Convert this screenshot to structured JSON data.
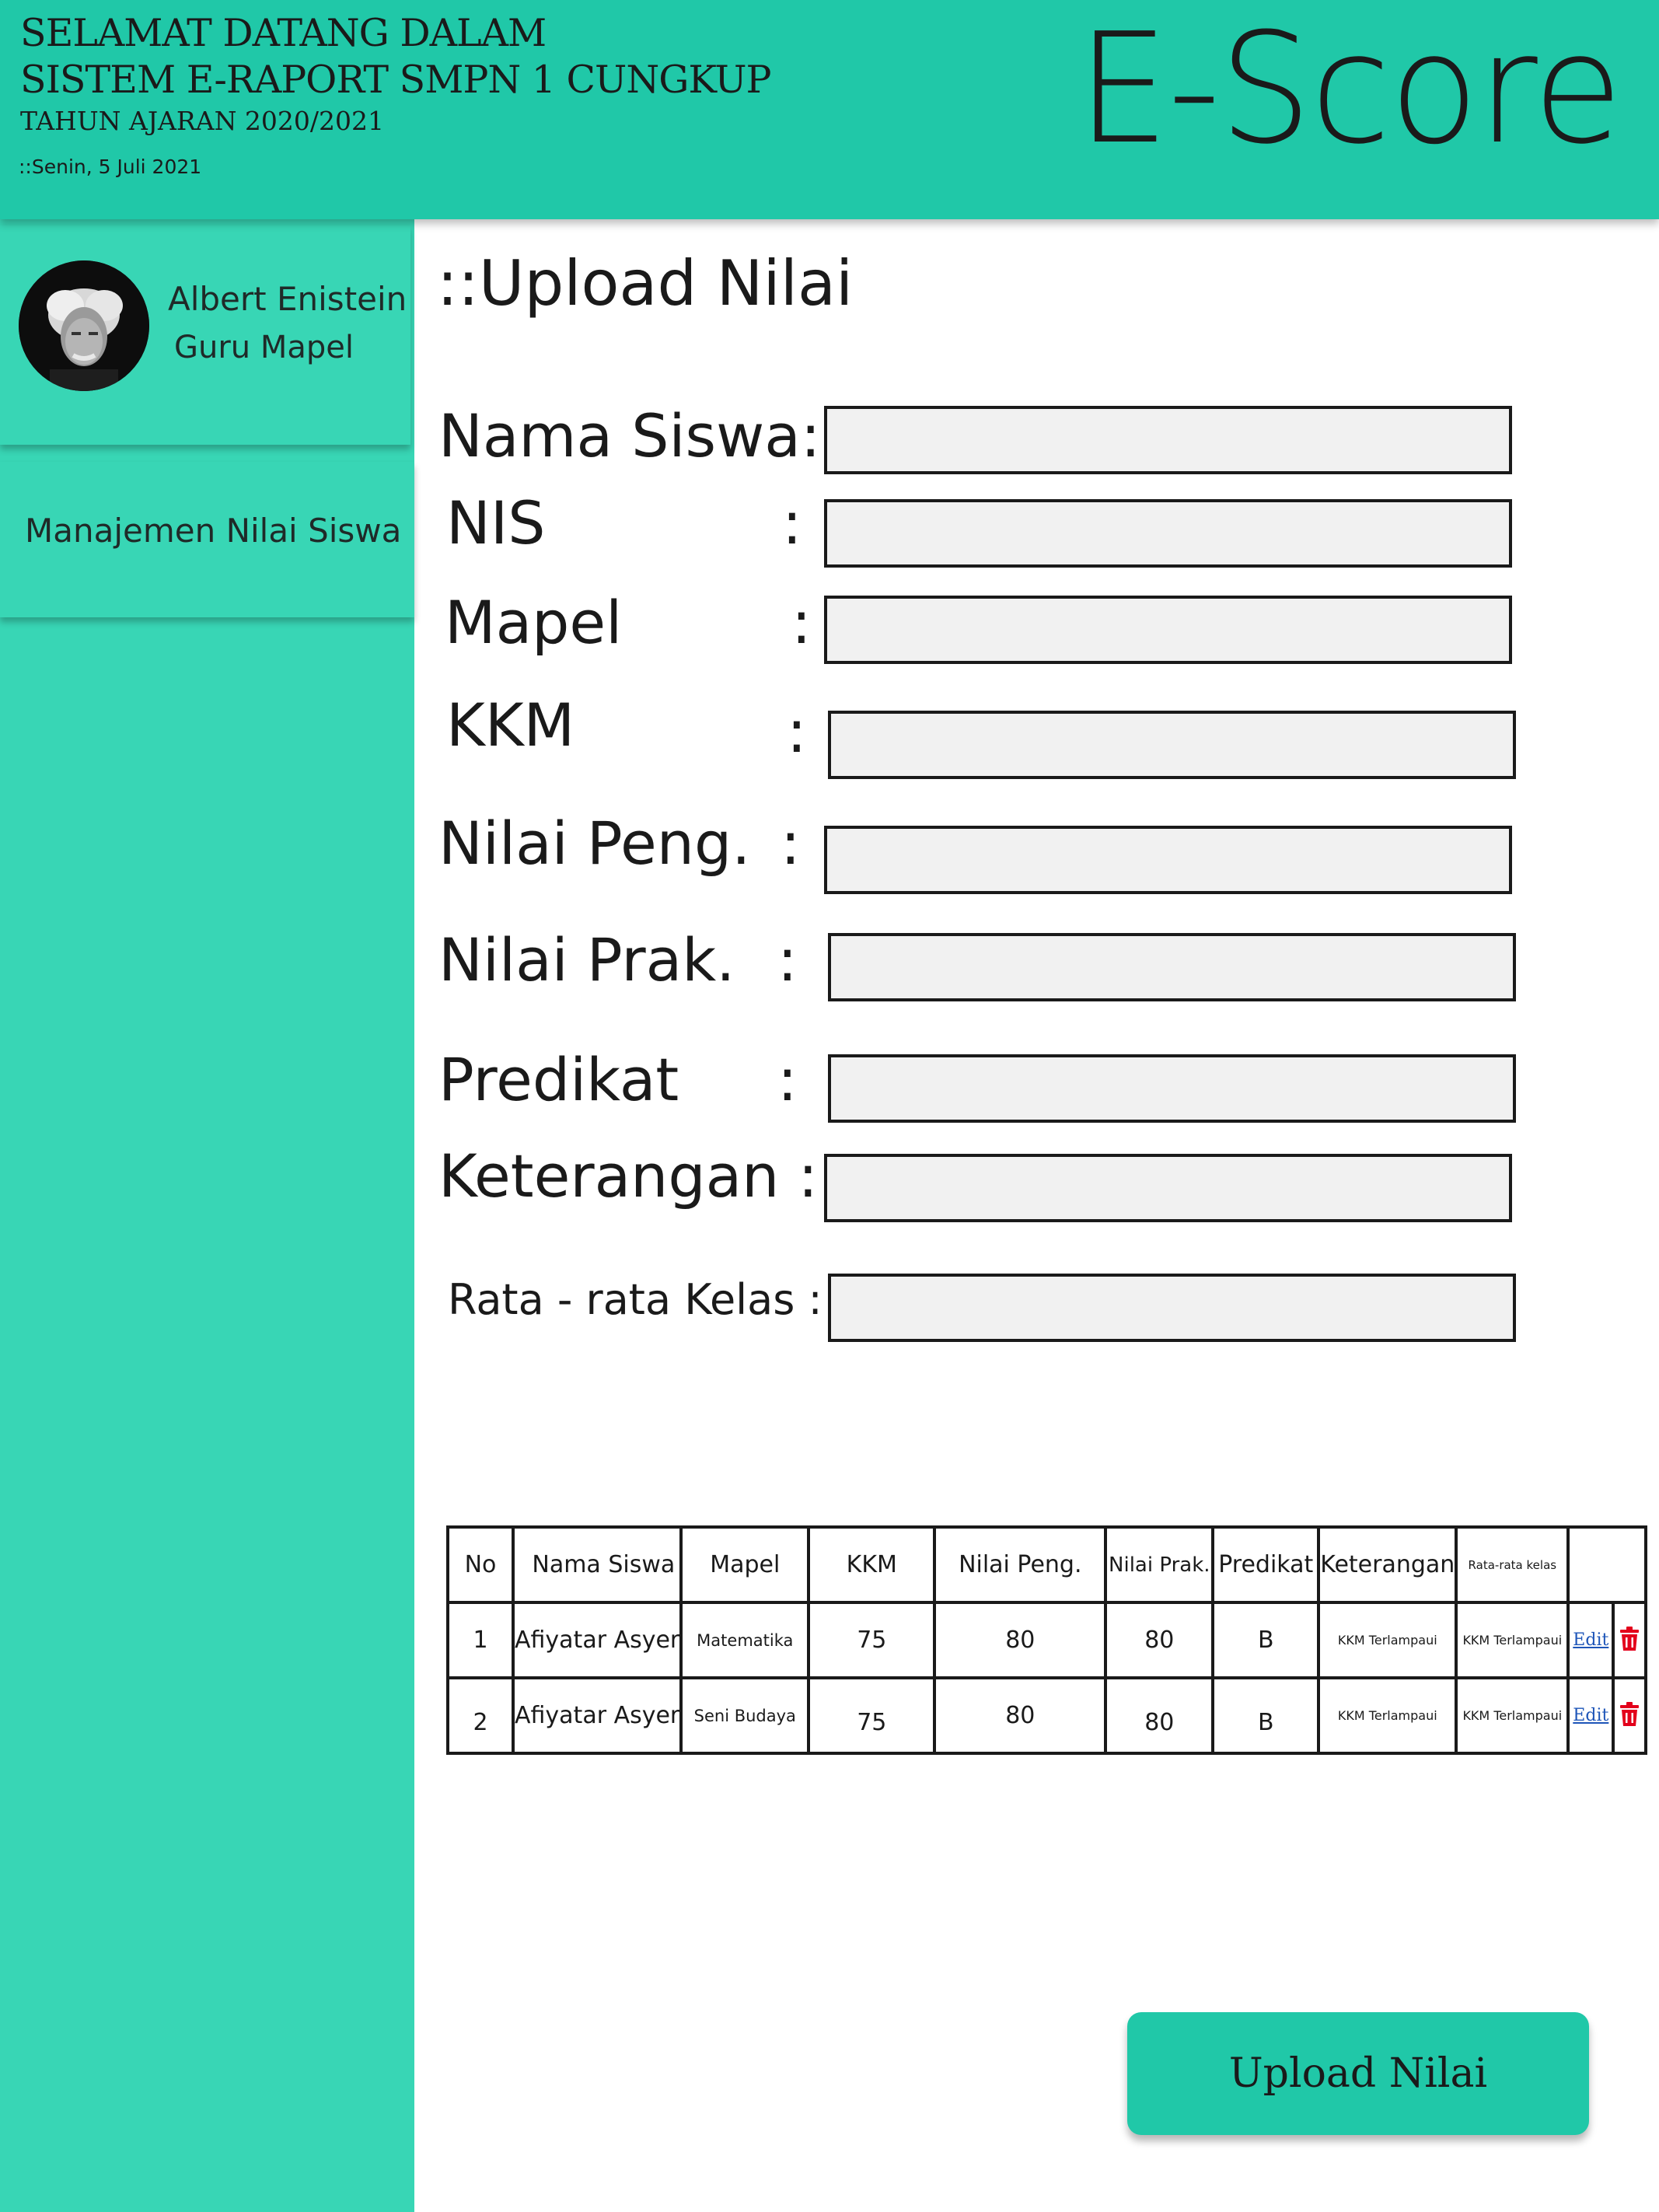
{
  "header": {
    "line1": "SELAMAT DATANG DALAM",
    "line2": "SISTEM E-RAPORT SMPN 1 CUNGKUP",
    "line3": "TAHUN AJARAN 2020/2021",
    "date": "::Senin, 5 Juli 2021",
    "brand": "E-Score"
  },
  "sidebar": {
    "user_name": "Albert Enistein",
    "user_role": "Guru Mapel",
    "nav_item": "Manajemen Nilai Siswa"
  },
  "main": {
    "title": "::Upload Nilai",
    "fields": {
      "nama": {
        "label": "Nama Siswa:",
        "value": ""
      },
      "nis": {
        "label": "NIS",
        "colon": ":",
        "value": ""
      },
      "mapel": {
        "label": "Mapel",
        "colon": ":",
        "value": ""
      },
      "kkm": {
        "label": "KKM",
        "colon": ":",
        "value": ""
      },
      "peng": {
        "label": "Nilai Peng.",
        "colon": ":",
        "value": ""
      },
      "prak": {
        "label": "Nilai Prak.",
        "colon": ":",
        "value": ""
      },
      "predikat": {
        "label": "Predikat",
        "colon": ":",
        "value": ""
      },
      "keterangan": {
        "label": "Keterangan :",
        "value": ""
      },
      "rata": {
        "label": "Rata - rata Kelas :",
        "value": ""
      }
    },
    "table": {
      "headers": [
        "No",
        "Nama Siswa",
        "Mapel",
        "KKM",
        "Nilai Peng.",
        "Nilai Prak.",
        "Predikat",
        "Keterangan",
        "Rata-rata kelas"
      ],
      "rows": [
        {
          "no": "1",
          "nama": "Afiyatar Asyer",
          "mapel": "Matematika",
          "kkm": "75",
          "peng": "80",
          "prak": "80",
          "predikat": "B",
          "keterangan": "KKM Terlampaui",
          "rata": "KKM Terlampaui",
          "edit": "Edit"
        },
        {
          "no": "2",
          "nama": "Afiyatar Asyer",
          "mapel": "Seni Budaya",
          "kkm": "75",
          "peng": "80",
          "prak": "80",
          "predikat": "B",
          "keterangan": "KKM Terlampaui",
          "rata": "KKM Terlampaui",
          "edit": "Edit"
        }
      ]
    },
    "upload_button": "Upload Nilai"
  },
  "colors": {
    "header_bg": "#20c8a8",
    "sidebar_bg": "#38d6b5",
    "input_bg": "#f1f1f1",
    "link": "#1e55b8",
    "delete": "#e3001b"
  },
  "icons": {
    "delete": "trash-icon",
    "avatar": "profile-photo"
  }
}
